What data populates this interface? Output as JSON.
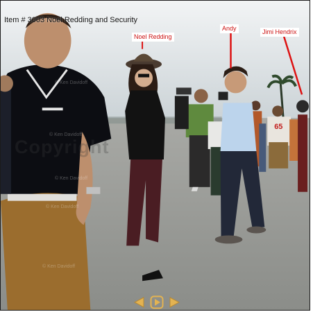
{
  "photo": {
    "title": "Item # 3003 Noel Redding and Security",
    "labels": {
      "noel": "Noel Redding",
      "andy": "Andy",
      "jimi": "Jimi Hendrix"
    },
    "watermark": "© Ken Davidoff",
    "watermark_big": "Copyright",
    "jersey_number": "65"
  },
  "nav": {
    "prev_icon": "left-arrow-icon",
    "play_icon": "play-icon",
    "next_icon": "right-arrow-icon"
  },
  "colors": {
    "label_text": "#cc1111",
    "arrow": "#dd1111",
    "nav_gold": "#e3b352"
  }
}
